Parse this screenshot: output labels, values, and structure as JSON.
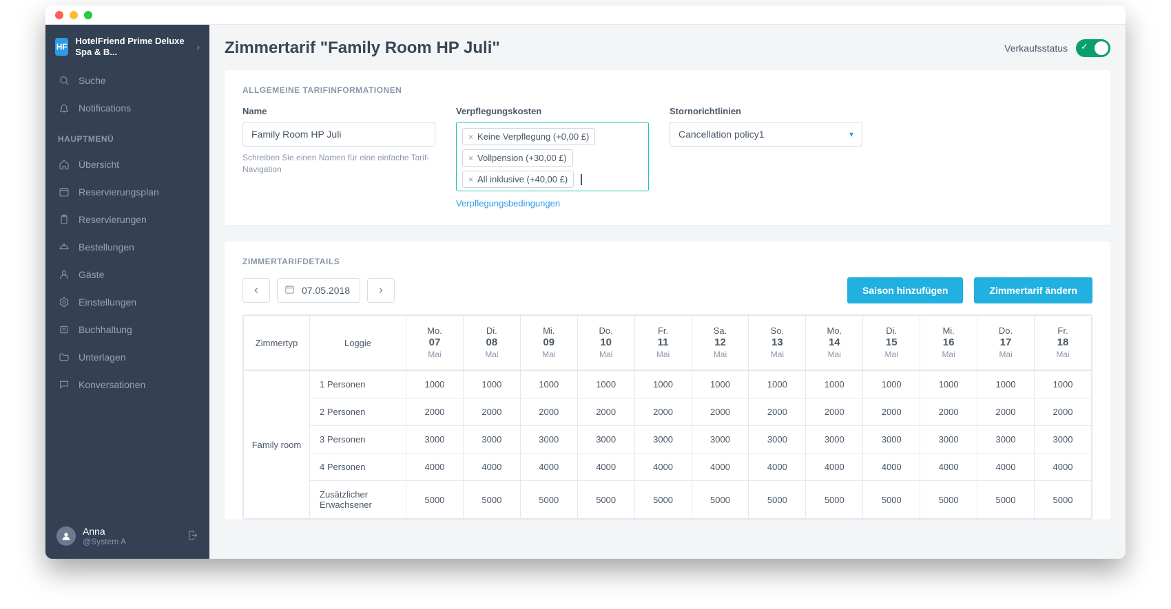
{
  "brand": {
    "name": "HotelFriend Prime Deluxe Spa & B..."
  },
  "sidebar": {
    "search": "Suche",
    "notifications": "Notifications",
    "section": "HAUPTMENÜ",
    "items": [
      "Übersicht",
      "Reservierungsplan",
      "Reservierungen",
      "Bestellungen",
      "Gäste",
      "Einstellungen",
      "Buchhaltung",
      "Unterlagen",
      "Konversationen"
    ]
  },
  "user": {
    "name": "Anna",
    "sub": "@System A"
  },
  "header": {
    "title": "Zimmertarif \"Family Room HP Juli\"",
    "status_label": "Verkaufsstatus"
  },
  "info": {
    "section": "ALLGEMEINE TARIFINFORMATIONEN",
    "name_label": "Name",
    "name_value": "Family Room HP Juli",
    "name_help": "Schreiben Sie einen Namen für eine einfache Tarif-Navigation",
    "meal_label": "Verpflegungskosten",
    "meal_tags": [
      "Keine Verpflegung (+0,00 £)",
      "Vollpension (+30,00 £)",
      "All inklusive (+40,00 £)"
    ],
    "meal_link": "Verpflegungsbedingungen",
    "cancel_label": "Stornorichtlinien",
    "cancel_value": "Cancellation policy1"
  },
  "details": {
    "section": "ZIMMERTARIFDETAILS",
    "date": "07.05.2018",
    "btn_add_season": "Saison hinzufügen",
    "btn_change_rate": "Zimmertarif ändern",
    "col_roomtype": "Zimmertyp",
    "col_loggie": "Loggie",
    "days": [
      {
        "dow": "Mo.",
        "num": "07",
        "month": "Mai"
      },
      {
        "dow": "Di.",
        "num": "08",
        "month": "Mai"
      },
      {
        "dow": "Mi.",
        "num": "09",
        "month": "Mai"
      },
      {
        "dow": "Do.",
        "num": "10",
        "month": "Mai"
      },
      {
        "dow": "Fr.",
        "num": "11",
        "month": "Mai"
      },
      {
        "dow": "Sa.",
        "num": "12",
        "month": "Mai"
      },
      {
        "dow": "So.",
        "num": "13",
        "month": "Mai"
      },
      {
        "dow": "Mo.",
        "num": "14",
        "month": "Mai"
      },
      {
        "dow": "Di.",
        "num": "15",
        "month": "Mai"
      },
      {
        "dow": "Mi.",
        "num": "16",
        "month": "Mai"
      },
      {
        "dow": "Do.",
        "num": "17",
        "month": "Mai"
      },
      {
        "dow": "Fr.",
        "num": "18",
        "month": "Mai"
      }
    ],
    "room_type": "Family room",
    "rows": [
      {
        "label": "1 Personen",
        "values": [
          "1000",
          "1000",
          "1000",
          "1000",
          "1000",
          "1000",
          "1000",
          "1000",
          "1000",
          "1000",
          "1000",
          "1000"
        ]
      },
      {
        "label": "2 Personen",
        "values": [
          "2000",
          "2000",
          "2000",
          "2000",
          "2000",
          "2000",
          "2000",
          "2000",
          "2000",
          "2000",
          "2000",
          "2000"
        ]
      },
      {
        "label": "3 Personen",
        "values": [
          "3000",
          "3000",
          "3000",
          "3000",
          "3000",
          "3000",
          "3000",
          "3000",
          "3000",
          "3000",
          "3000",
          "3000"
        ]
      },
      {
        "label": "4 Personen",
        "values": [
          "4000",
          "4000",
          "4000",
          "4000",
          "4000",
          "4000",
          "4000",
          "4000",
          "4000",
          "4000",
          "4000",
          "4000"
        ]
      },
      {
        "label": "Zusätzlicher Erwachsener",
        "values": [
          "5000",
          "5000",
          "5000",
          "5000",
          "5000",
          "5000",
          "5000",
          "5000",
          "5000",
          "5000",
          "5000",
          "5000"
        ]
      }
    ]
  }
}
